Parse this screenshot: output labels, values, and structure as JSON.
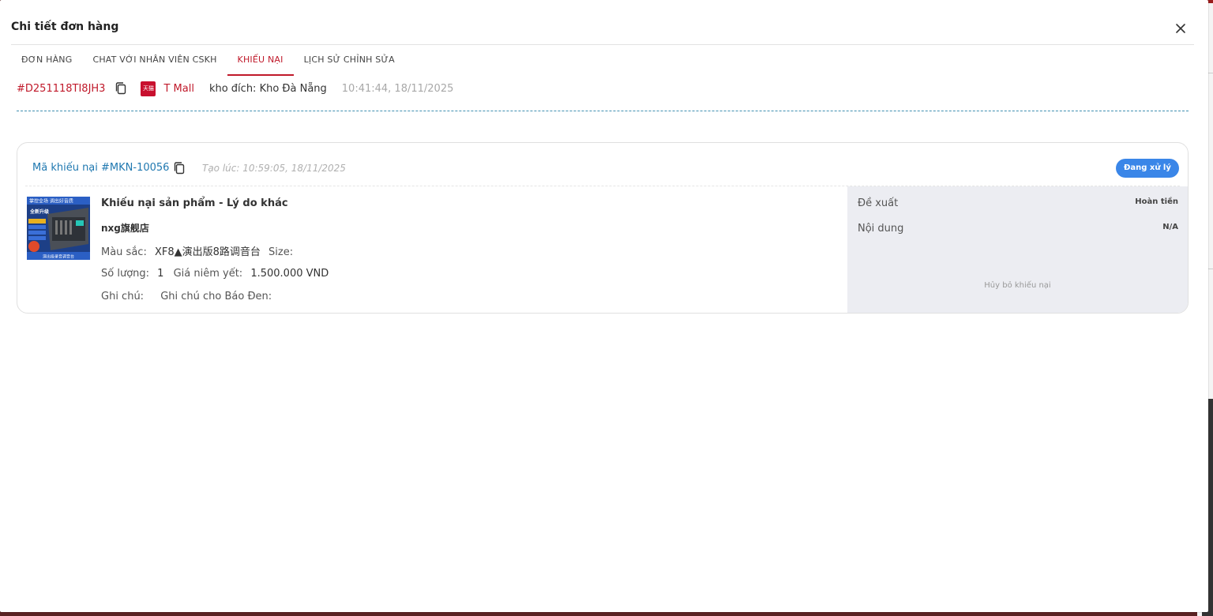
{
  "modal": {
    "title": "Chi tiết đơn hàng"
  },
  "tabs": [
    {
      "label": "ĐƠN HÀNG",
      "active": false
    },
    {
      "label": "CHAT VỚI NHÂN VIÊN CSKH",
      "active": false
    },
    {
      "label": "KHIẾU NẠI",
      "active": true
    },
    {
      "label": "LỊCH SỬ CHỈNH SỬA",
      "active": false
    }
  ],
  "order": {
    "id": "#D251118TI8JH3",
    "platform_logo_text": "天猫",
    "platform": "T Mall",
    "warehouse": "kho đích: Kho Đà Nẵng",
    "time": "10:41:44, 18/11/2025"
  },
  "complaint": {
    "code": "Mã khiếu nại #MKN-10056",
    "created": "Tạo lúc: 10:59:05, 18/11/2025",
    "status": "Đang xử lý",
    "product_title": "Khiếu nại sản phẩm - Lý do khác",
    "shop": "nxg旗舰店",
    "color_label": "Màu sắc:",
    "color_value": "XF8▲演出版8路调音台",
    "size_label": "Size:",
    "size_value": "",
    "qty_label": "Số lượng:",
    "qty_value": "1",
    "price_label": "Giá niêm yết:",
    "price_value": "1.500.000 VND",
    "note_label": "Ghi chú:",
    "note_value": "Ghi chú cho Báo Đen:",
    "proposal_label": "Đề xuất",
    "proposal_value": "Hoàn tiền",
    "content_label": "Nội dung",
    "content_value": "N/A",
    "cancel_label": "Hủy bỏ khiếu nại",
    "thumb_text_top": "掌控全场 调出好音质",
    "thumb_text_mid": "全新升级",
    "thumb_text_bottom": "演出级录音调音台"
  },
  "colors": {
    "accent": "#c0192a",
    "link": "#1f78b0",
    "status_badge": "#3a86e8",
    "side_panel": "#ecedf2"
  }
}
